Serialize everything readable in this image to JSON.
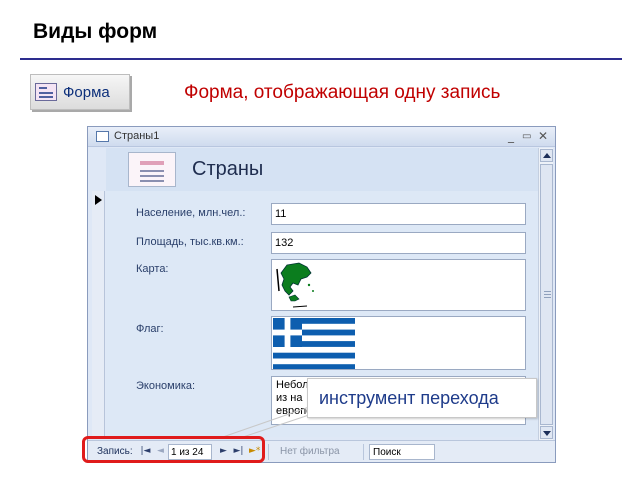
{
  "slide": {
    "title": "Виды форм",
    "caption": "Форма, отображающая одну запись",
    "forma_button": {
      "label": "Форма"
    },
    "callout": "инструмент перехода"
  },
  "window": {
    "title": "Страны1",
    "controls": {
      "minimize": "_",
      "maximize": "▭",
      "close": "✕"
    },
    "form_header": "Страны",
    "fields": [
      {
        "label": "Население, млн.чел.:",
        "value": "11"
      },
      {
        "label": "Площадь, тыс.кв.км.:",
        "value": "132"
      },
      {
        "label": "Карта:"
      },
      {
        "label": "Флаг:"
      },
      {
        "label": "Экономика:",
        "value": "Небол\n из на\nевропейс... ..., но с великим"
      }
    ]
  },
  "navbar": {
    "label": "Запись:",
    "first": "|◄",
    "prev": "◄",
    "current": "1 из 24",
    "next": "►",
    "last": "►|",
    "new": "►*",
    "filter": "Нет фильтра",
    "search": "Поиск"
  },
  "colors": {
    "title_rule": "#2d2d8e",
    "caption": "#c00000",
    "highlight": "#e01b1b",
    "callout_text": "#1e3b8a",
    "map_green": "#0b7d1e",
    "flag_blue": "#0d5eaf"
  }
}
